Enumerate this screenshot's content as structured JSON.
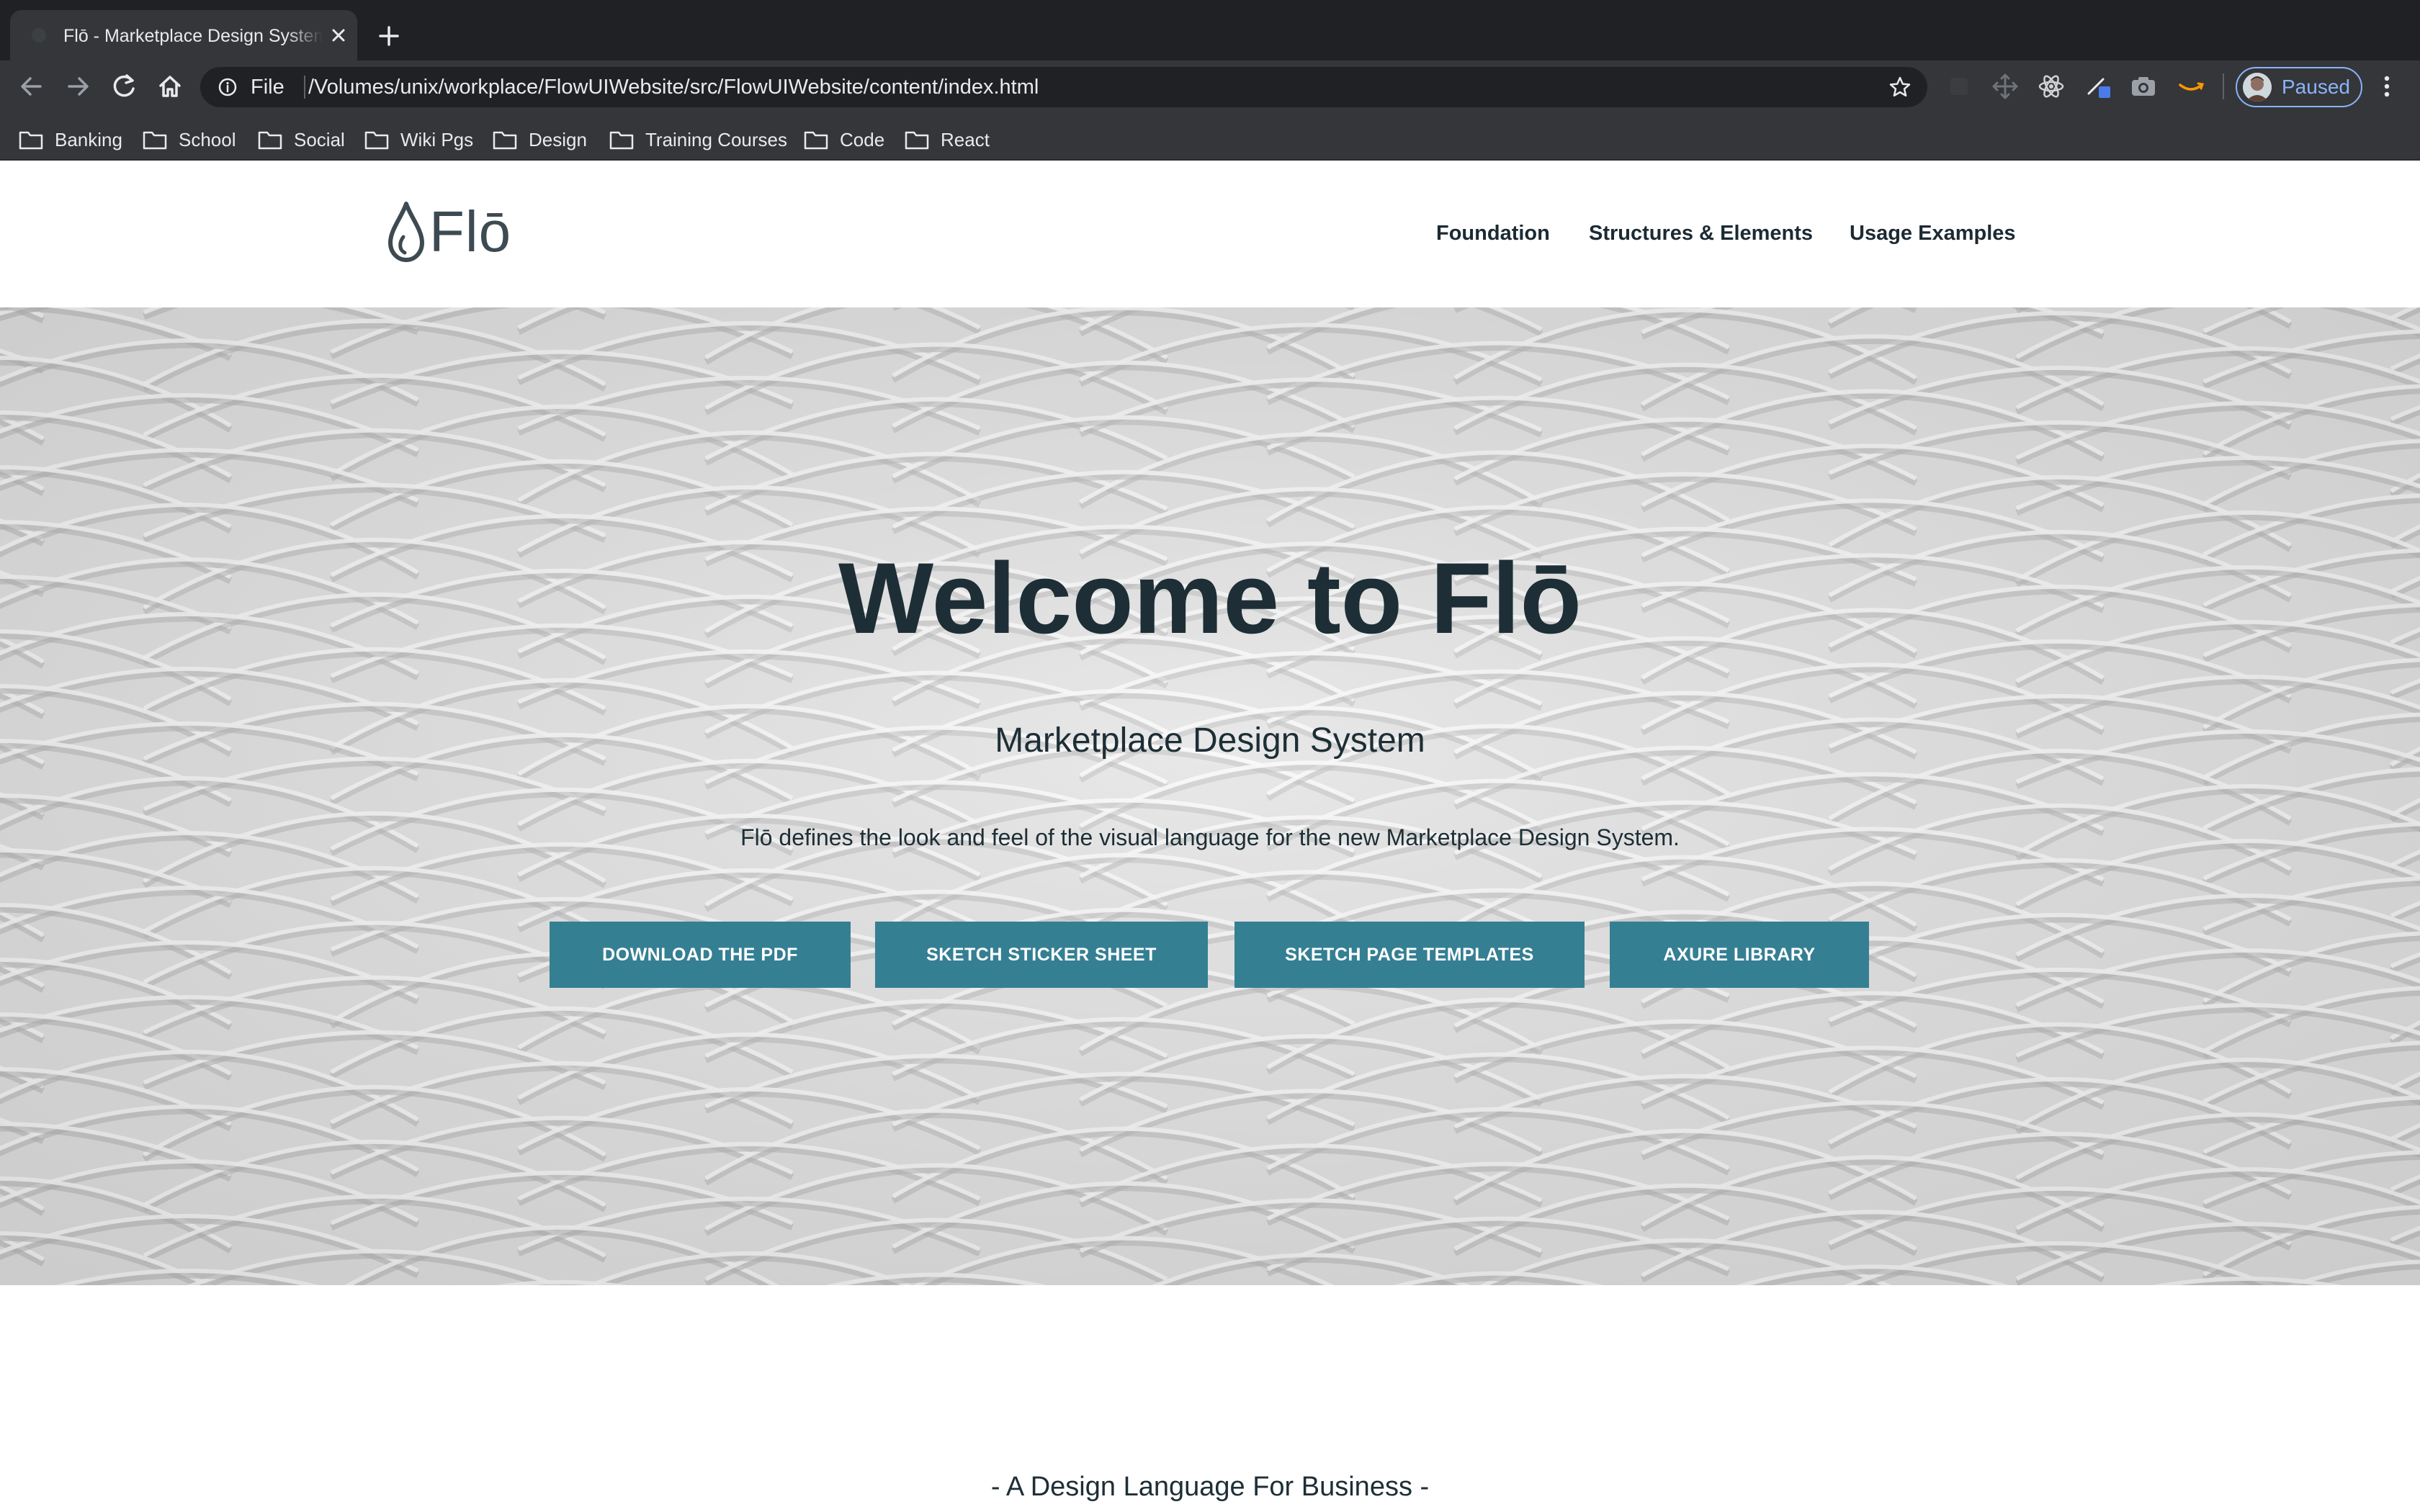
{
  "browser": {
    "tab_title": "Flō - Marketplace Design System",
    "url_scheme": "File",
    "url": "/Volumes/unix/workplace/FlowUIWebsite/src/FlowUIWebsite/content/index.html",
    "profile_status": "Paused",
    "bookmarks": [
      "Banking",
      "School",
      "Social",
      "Wiki Pgs",
      "Design",
      "Training Courses",
      "Code",
      "React"
    ],
    "icons": [
      "back-icon",
      "forward-icon",
      "reload-icon",
      "home-icon",
      "info-icon",
      "star-icon",
      "extension-icons",
      "more-icon"
    ]
  },
  "site": {
    "logo_text": "Flō",
    "nav": [
      "Foundation",
      "Structures & Elements",
      "Usage Examples"
    ]
  },
  "hero": {
    "title": "Welcome to Flō",
    "subtitle": "Marketplace Design System",
    "description": "Flō defines the look and feel of the visual language for the new Marketplace Design System.",
    "buttons": [
      "DOWNLOAD THE PDF",
      "SKETCH STICKER SHEET",
      "SKETCH PAGE TEMPLATES",
      "AXURE LIBRARY"
    ]
  },
  "section": {
    "heading": "- A Design Language For Business -"
  },
  "colors": {
    "chrome_dark": "#202124",
    "chrome_toolbar": "#35363a",
    "brand_teal": "#357f93",
    "heading_text": "#1d2e36",
    "profile_accent": "#8ab4f8"
  }
}
